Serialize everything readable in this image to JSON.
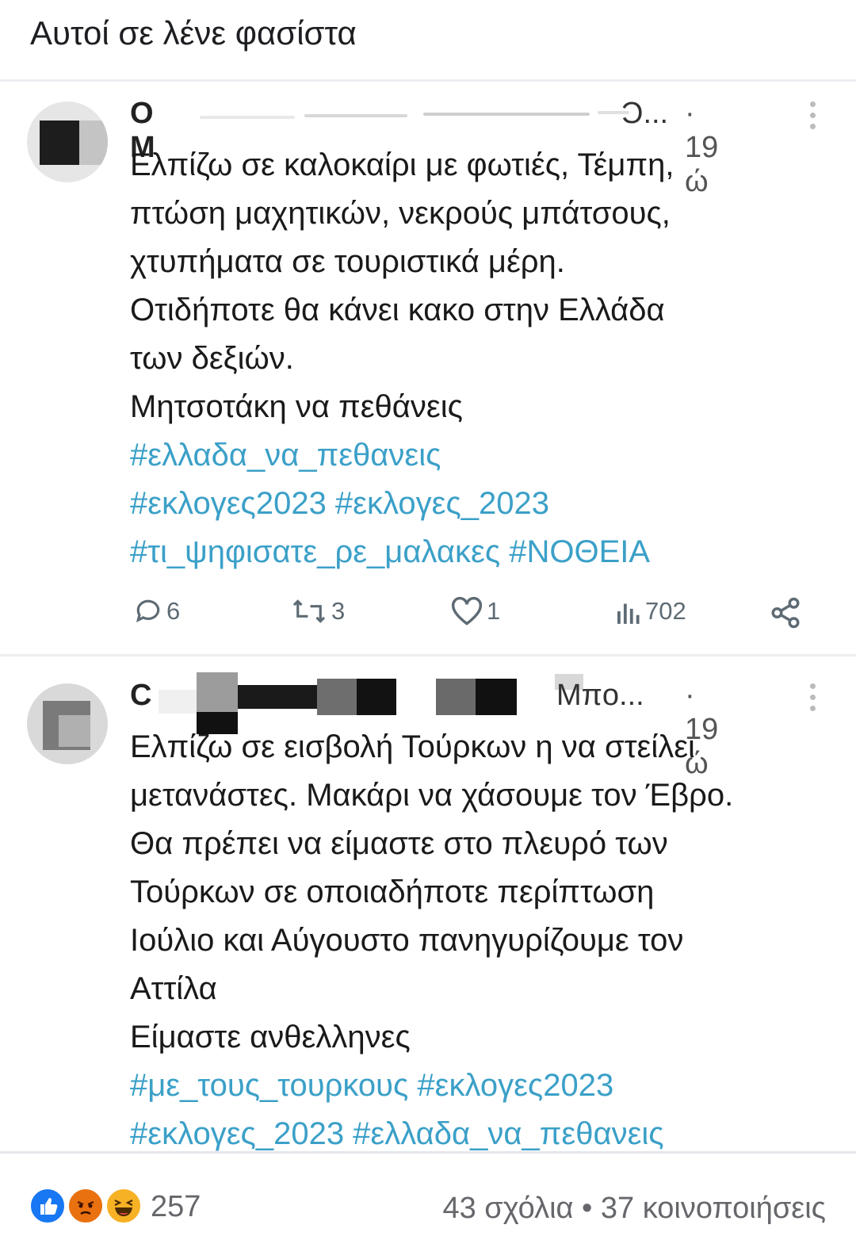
{
  "post": {
    "caption": "Αυτοί σε λένε φασίστα"
  },
  "tweets": [
    {
      "name_start": "Ο Μ",
      "handle_end": "Ͻ...",
      "time": "· 19 ώ",
      "lines": [
        "Ελπίζω σε καλοκαίρι με φωτιές, Τέμπη,",
        "πτώση μαχητικών, νεκρούς μπάτσους,",
        "χτυπήματα σε τουριστικά μέρη.",
        "Οτιδήποτε θα κάνει κακο στην Ελλάδα",
        "των δεξιών.",
        "Μητσοτάκη να πεθάνεις"
      ],
      "hashtag_lines": [
        "#ελλαδα_να_πεθανεις",
        "#εκλογες2023 #εκλογες_2023",
        "#τι_ψηφισατε_ρε_μαλακες #ΝΟΘΕΙΑ"
      ],
      "replies": "6",
      "retweets": "3",
      "likes": "1",
      "views": "702"
    },
    {
      "name_start": "C",
      "handle_end": "Mπo...",
      "time": "· 19 ώ",
      "lines": [
        "Ελπίζω σε εισβολή Τούρκων η να στείλει",
        "μετανάστες. Μακάρι να χάσουμε τον Έβρο.",
        "Θα πρέπει να είμαστε στο πλευρό των",
        "Τούρκων σε οποιαδήποτε περίπτωση",
        "Ιούλιο και Αύγουστο πανηγυρίζουμε τον",
        "Αττίλα",
        "Είμαστε ανθελληνες"
      ],
      "hashtag_lines": [
        "#με_τους_τουρκους #εκλογες2023",
        "#εκλογες_2023 #ελλαδα_να_πεθανεις"
      ]
    }
  ],
  "footer": {
    "reaction_icons": [
      "like-icon",
      "angry-icon",
      "haha-icon"
    ],
    "reaction_count": "257",
    "comments_shares": "43 σχόλια • 37 κοινοποιήσεις"
  },
  "colors": {
    "hashtag": "#3ba0c8",
    "like": "#1877f2",
    "angry": "#e9710f",
    "haha": "#f7b125"
  }
}
